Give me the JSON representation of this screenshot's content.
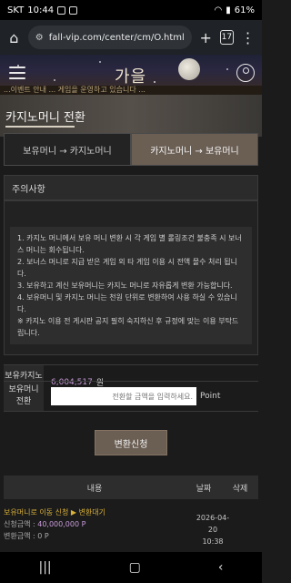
{
  "status_bar": {
    "carrier": "SKT",
    "time": "10:44",
    "battery": "61%"
  },
  "browser": {
    "url": "fall-vip.com/center/cm/O.html",
    "tab_count": "17"
  },
  "site": {
    "logo": "가을",
    "marquee": "...이벤트 안내 ... 게임을 운영하고 있습니다 ..."
  },
  "page": {
    "title": "카지노머니 전환"
  },
  "tabs": [
    {
      "label": "보유머니 → 카지노머니"
    },
    {
      "label": "카지노머니 → 보유머니"
    }
  ],
  "notice": {
    "header": "주의사항",
    "lines": [
      "1. 카지노 머니에서 보유 머니 변환 시 각 게임 별 롤링조건 불충족 시 보너스 머니는 회수됩니다.",
      "2. 보너스 머니로 지급 받은 게임 외 타 게임 이용 시 전액 몰수 처리 됩니다.",
      "3. 보유하고 계신 보유머니는 카지노 머니로 자유롭게 변환 가능합니다.",
      "4. 보유머니 및 카지노 머니는 천원 단위로 변환하여 사용 하실 수 있습니다.",
      "※ 카지노 이용 전 게시판 공지 필히 숙지하신 후 규정에 맞는 이용 부탁드립니다."
    ]
  },
  "form": {
    "casino_money_label": "보유카지노머니",
    "casino_money_value": "6,004,517",
    "casino_money_unit": "원",
    "convert_label": "보유머니 전환",
    "convert_placeholder": "전환할 금액을 입력하세요.",
    "convert_unit": "Point",
    "submit_label": "변환신청"
  },
  "history": {
    "columns": [
      "내용",
      "날짜",
      "삭제"
    ],
    "rows": [
      {
        "title": "보유머니로 이동 신청 ▶ 변환대기",
        "request_label": "신청금액 : ",
        "request_value": "40,000,000 P",
        "convert_label": "변환금액 : ",
        "convert_value": "0 P",
        "date": "2026-04-20",
        "time": "10:38"
      }
    ]
  },
  "icons": {
    "home": "home-icon",
    "site_info": "site-info-icon",
    "new_tab": "plus-icon",
    "menu": "more-vert-icon",
    "hamburger": "hamburger-icon",
    "user": "user-icon",
    "recents": "recents-icon",
    "home_nav": "home-nav-icon",
    "back": "back-icon"
  },
  "colors": {
    "accent": "#6b5f54",
    "amount": "#c79bd8",
    "status": "#d9b13a"
  }
}
